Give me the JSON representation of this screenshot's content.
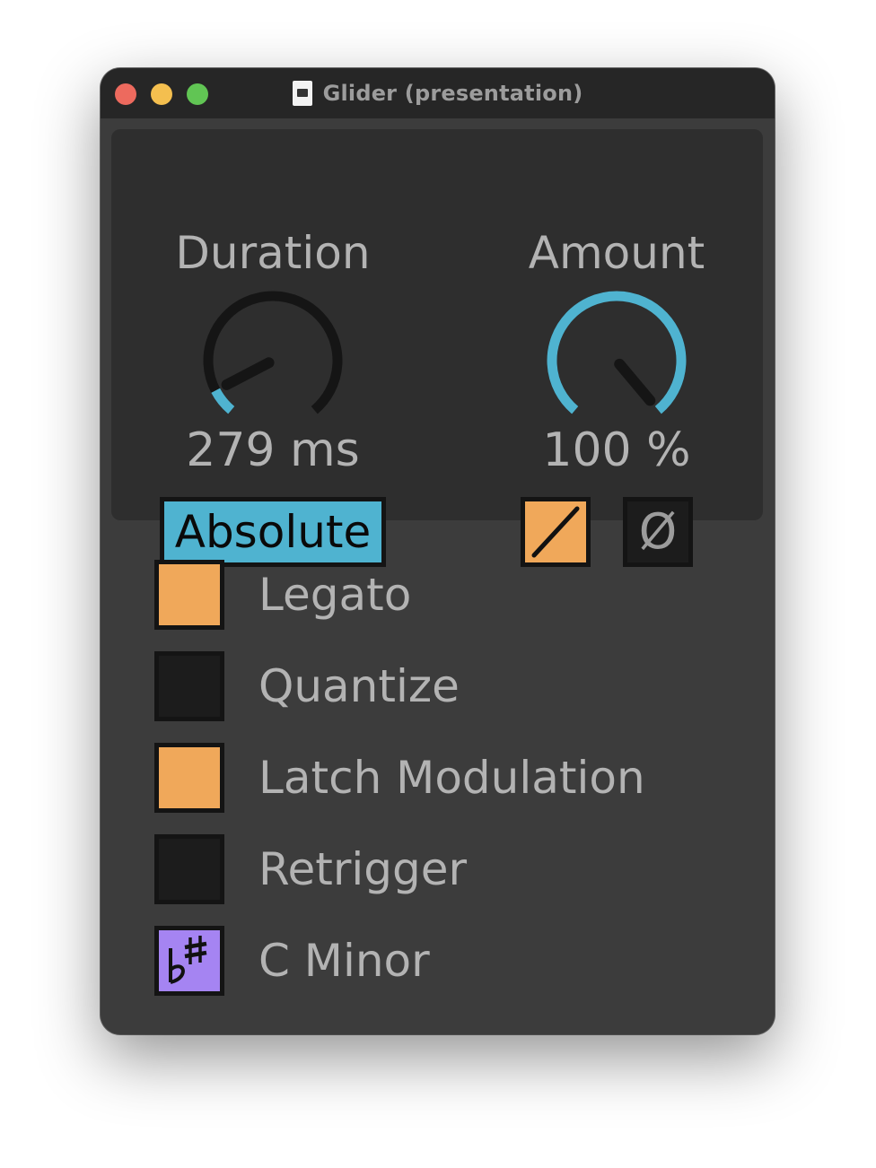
{
  "window": {
    "title": "Glider (presentation)",
    "file_icon": "max-patch-file-icon"
  },
  "duration": {
    "label": "Duration",
    "value_text": "279 ms",
    "knob_fraction": 0.08,
    "mode_label": "Absolute"
  },
  "amount": {
    "label": "Amount",
    "value_text": "100 %",
    "knob_fraction": 1.0,
    "curve_button_icon": "diagonal-line-icon",
    "curve_button_on": true,
    "phase_label": "Ø",
    "phase_button_on": false
  },
  "toggles": [
    {
      "label": "Legato",
      "on": true
    },
    {
      "label": "Quantize",
      "on": false
    },
    {
      "label": "Latch Modulation",
      "on": true
    },
    {
      "label": "Retrigger",
      "on": false
    },
    {
      "label": "C Minor",
      "icon": "flat-sharp-icon",
      "on": true
    }
  ],
  "colors": {
    "window_bg": "#3c3c3c",
    "titlebar_bg": "#262626",
    "panel_bg": "#2e2e2e",
    "accent_blue": "#4fb3d0",
    "toggle_on": "#f0a85a",
    "toggle_off": "#1c1c1c",
    "scale_purple": "#a584f2",
    "knob_track": "#151515",
    "label_text": "#b3b3b3"
  }
}
